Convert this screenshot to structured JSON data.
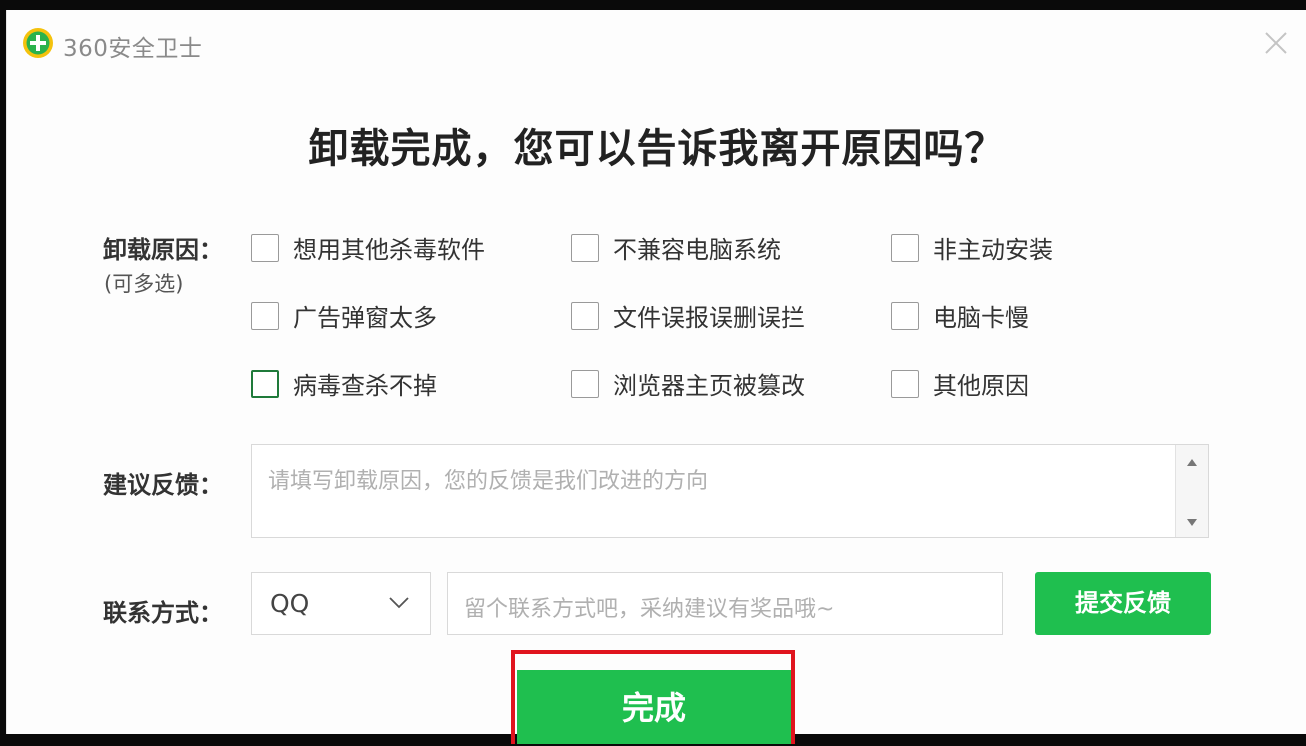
{
  "titlebar": {
    "app_title": "360安全卫士"
  },
  "headline": "卸载完成，您可以告诉我离开原因吗？",
  "reasons": {
    "label": "卸载原因：",
    "sublabel": "(可多选)",
    "options": [
      "想用其他杀毒软件",
      "不兼容电脑系统",
      "非主动安装",
      "广告弹窗太多",
      "文件误报误删误拦",
      "电脑卡慢",
      "病毒查杀不掉",
      "浏览器主页被篡改",
      "其他原因"
    ]
  },
  "feedback": {
    "label": "建议反馈：",
    "placeholder": "请填写卸载原因，您的反馈是我们改进的方向"
  },
  "contact": {
    "label": "联系方式：",
    "method": "QQ",
    "placeholder": "留个联系方式吧，采纳建议有奖品哦~",
    "submit_label": "提交反馈"
  },
  "done_label": "完成",
  "colors": {
    "accent_green": "#1fbf4f",
    "highlight_red": "#e0141e"
  }
}
